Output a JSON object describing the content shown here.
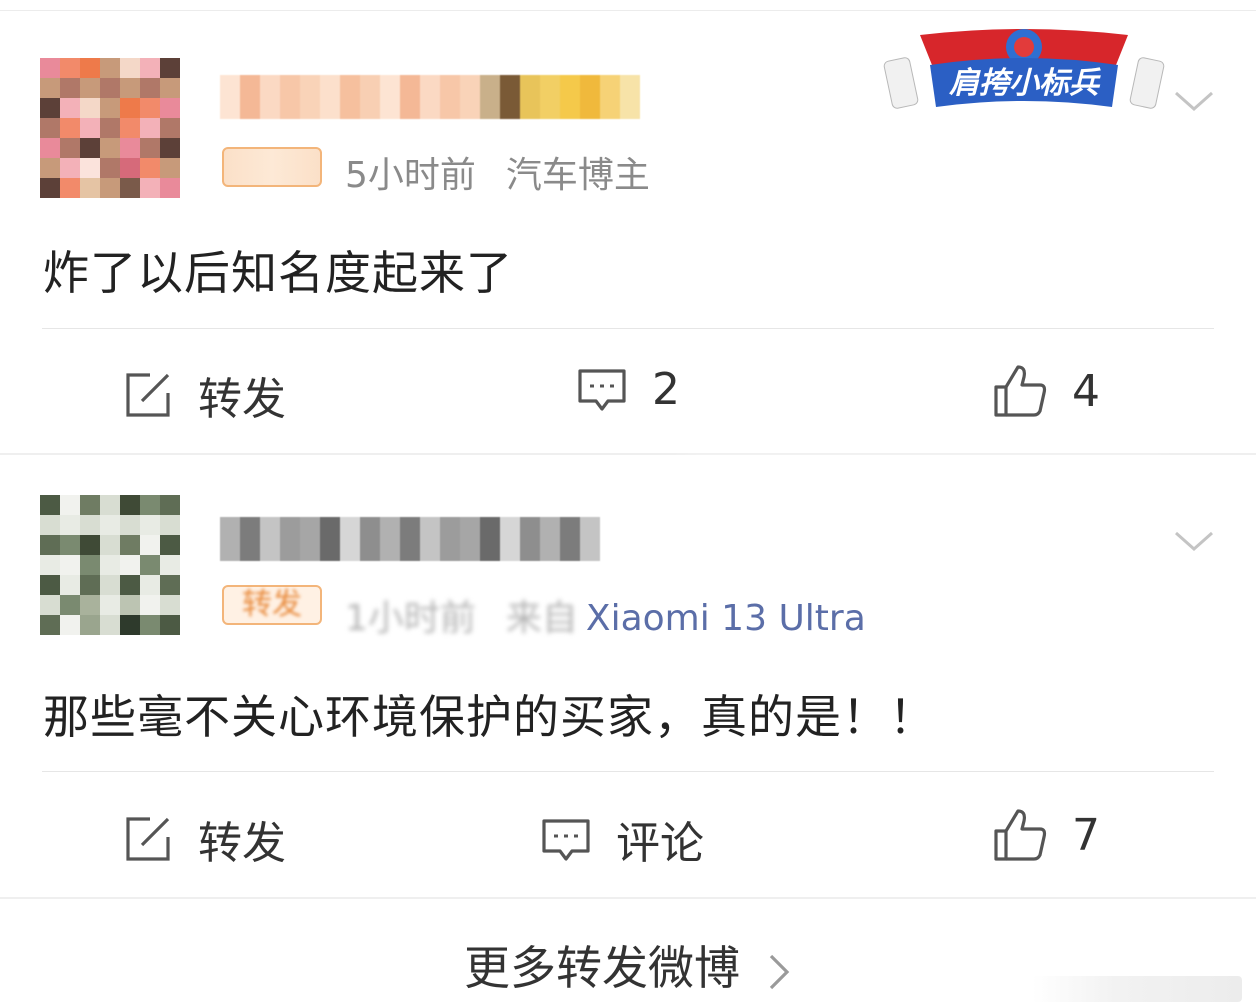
{
  "posts": [
    {
      "time": "5小时前",
      "source": "汽车博主",
      "content": "炸了以后知名度起来了",
      "actions": {
        "repost_label": "转发",
        "comment_count": "2",
        "like_count": "4"
      },
      "sticker_text": "肩挎小标兵"
    },
    {
      "time": "1小时前",
      "source_prefix": "来自",
      "device": "Xiaomi 13 Ultra",
      "badge_text": "转发",
      "content": "那些毫不关心环境保护的买家，真的是！！",
      "actions": {
        "repost_label": "转发",
        "comment_label": "评论",
        "like_count": "7"
      }
    }
  ],
  "footer": {
    "more_label": "更多转发微博"
  },
  "colors": {
    "accent_meta": "#8a8a8a",
    "device_link": "#5b6ea8",
    "divider": "#e6e6e6"
  }
}
